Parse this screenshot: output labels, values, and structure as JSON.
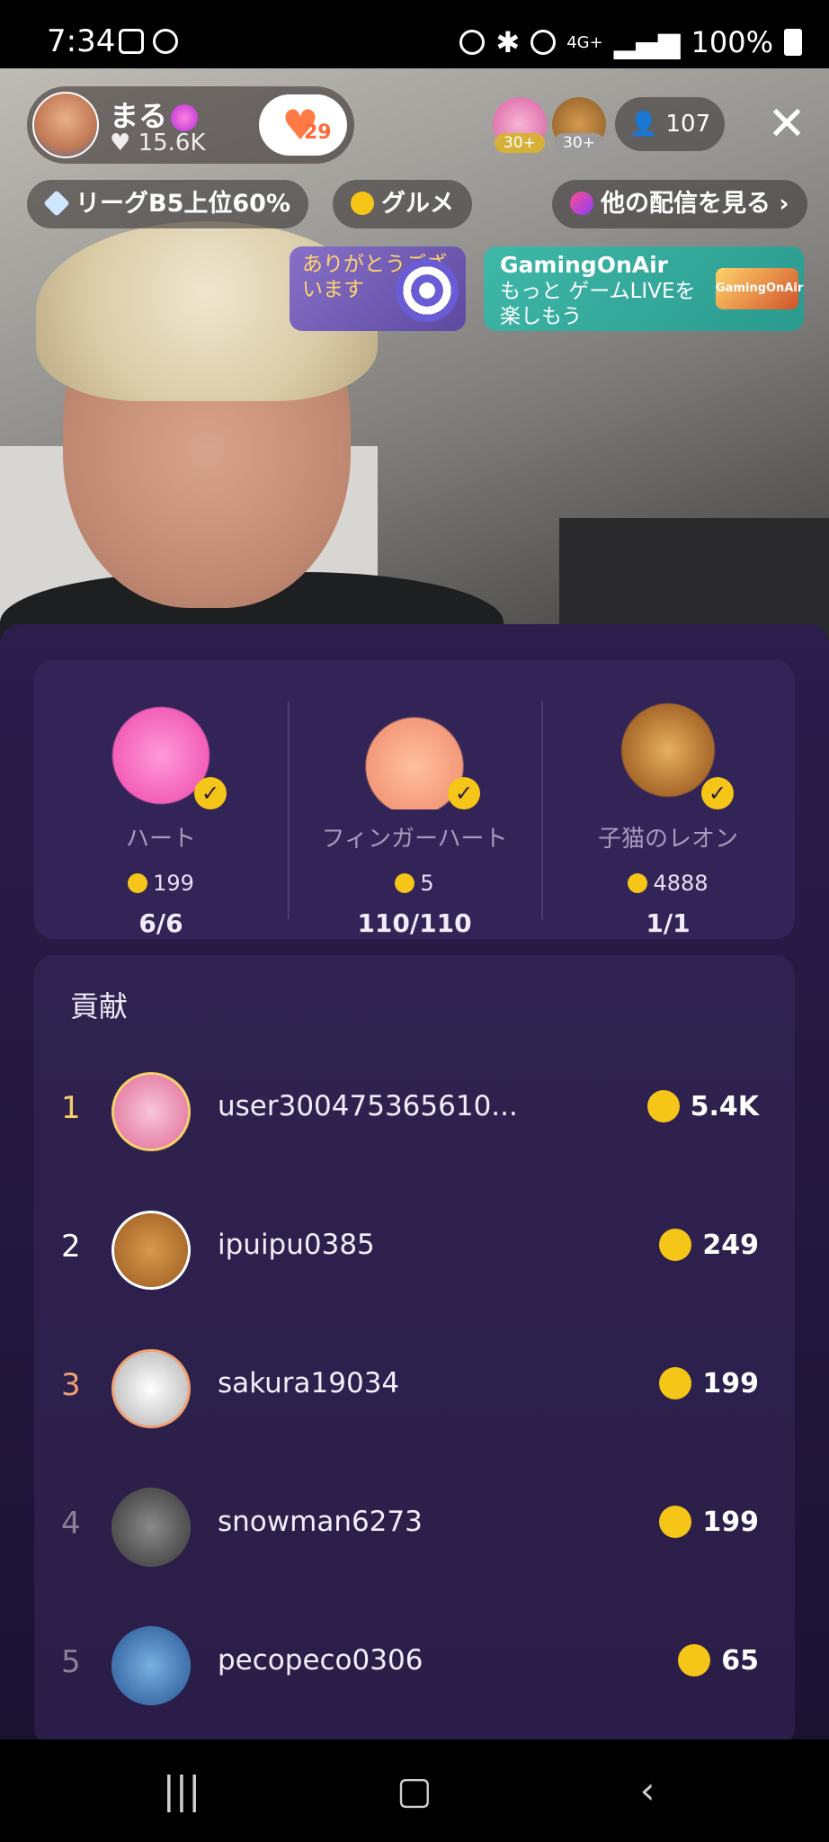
{
  "status": {
    "time": "7:34",
    "battery": "100%",
    "network": "4G+"
  },
  "host": {
    "name": "まる",
    "likes": "15.6K",
    "follow_count": "29"
  },
  "viewers": {
    "badges": [
      "30+",
      "30+"
    ],
    "count": "107"
  },
  "chips": {
    "league": "リーグB5上位60%",
    "category": "グルメ",
    "other_streams": "他の配信を見る"
  },
  "banners": {
    "thanks": "ありがとうございます",
    "gaming_title": "GamingOnAir",
    "gaming_sub": "もっと ゲームLIVEを楽しもう",
    "gaming_logo": "GamingOnAir"
  },
  "gifts": [
    {
      "name": "ハート",
      "price": "199",
      "progress": "6/6",
      "icon": "heart-gift-icon"
    },
    {
      "name": "フィンガーハート",
      "price": "5",
      "progress": "110/110",
      "icon": "finger-heart-icon"
    },
    {
      "name": "子猫のレオン",
      "price": "4888",
      "progress": "1/1",
      "icon": "lion-icon"
    }
  ],
  "contribution": {
    "title": "貢献",
    "rows": [
      {
        "rank": "1",
        "user": "user300475365610...",
        "score": "5.4K"
      },
      {
        "rank": "2",
        "user": "ipuipu0385",
        "score": "249"
      },
      {
        "rank": "3",
        "user": "sakura19034",
        "score": "199"
      },
      {
        "rank": "4",
        "user": "snowman6273",
        "score": "199"
      },
      {
        "rank": "5",
        "user": "pecopeco0306",
        "score": "65"
      }
    ]
  },
  "colors": {
    "panel": "#2b1d4c",
    "card": "#322456",
    "coin": "#f5c518",
    "rank1": "#f5d06a",
    "rank3": "#f0a070"
  }
}
